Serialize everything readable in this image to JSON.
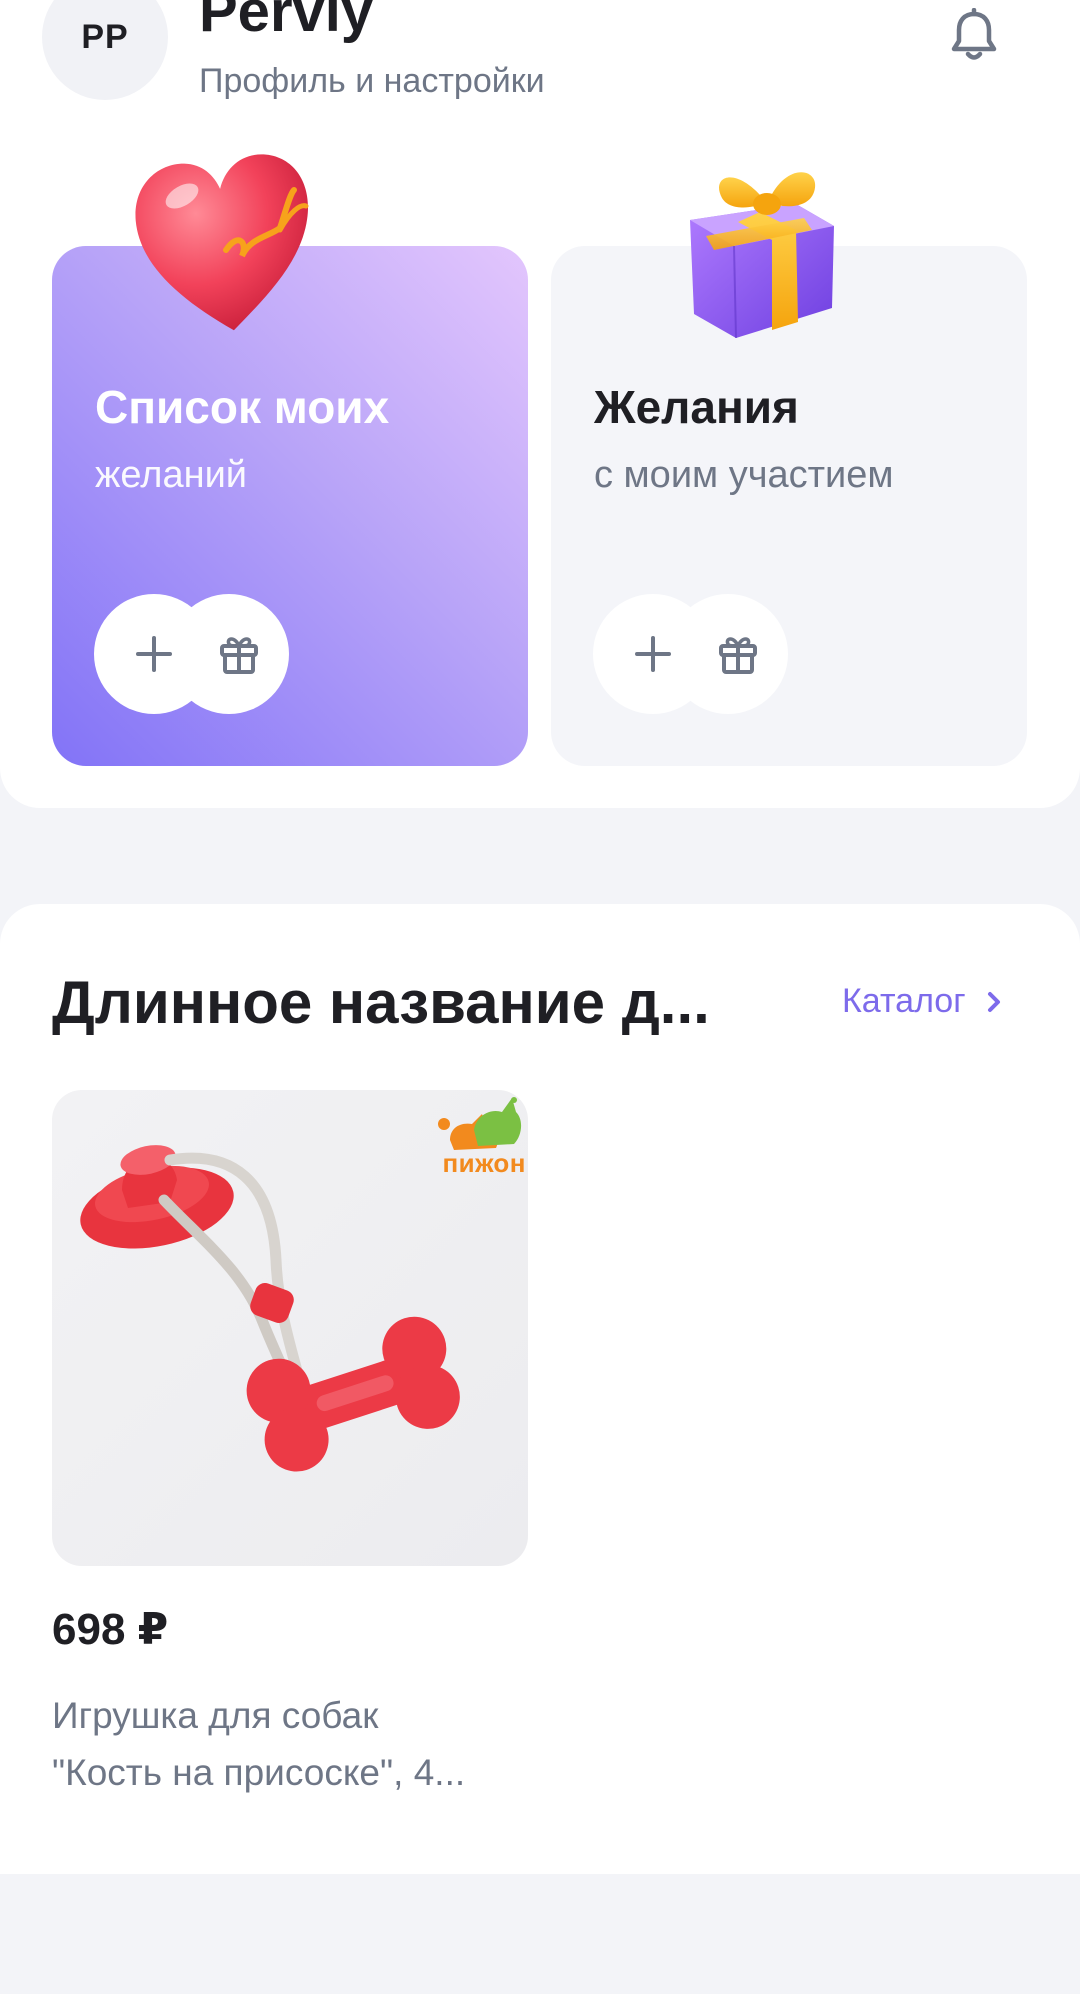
{
  "profile": {
    "initials": "PP",
    "username": "Perviy",
    "subtitle": "Профиль и настройки"
  },
  "icons": {
    "bell": "bell-icon",
    "plus": "plus-icon",
    "gift": "gift-icon",
    "chevron": "chevron-right-icon"
  },
  "cards": {
    "wishlist": {
      "title": "Список моих",
      "subtitle": "желаний",
      "colors": {
        "gradient_start": "#E3C6FD",
        "gradient_end": "#8273F7"
      }
    },
    "participation": {
      "title": "Желания",
      "subtitle": "с моим участием",
      "colors": {
        "background": "#F4F5F9"
      }
    }
  },
  "section": {
    "title": "Длинное название д...",
    "catalog_label": "Каталог",
    "accent_color": "#7D6BEB"
  },
  "product": {
    "brand": "пижон",
    "price": "698 ₽",
    "name_line1": "Игрушка для собак",
    "name_line2": "\"Кость на присоске\", 4..."
  }
}
